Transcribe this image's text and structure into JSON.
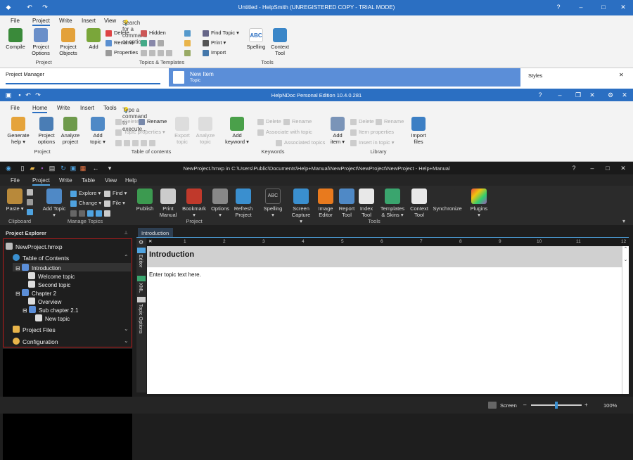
{
  "win1": {
    "title": "Untitled - HelpSmith (UNREGISTERED COPY - TRIAL MODE)",
    "menu": [
      "File",
      "Project",
      "Write",
      "Insert",
      "View"
    ],
    "search_placeholder": "Search for a command or option",
    "ribbon": {
      "compile": "Compile",
      "project_options": "Project Options",
      "project_objects": "Project Objects",
      "add": "Add",
      "delete": "Delete",
      "rename": "Rename",
      "properties": "Properties",
      "hidden": "Hidden",
      "find_topic": "Find Topic",
      "print": "Print",
      "import": "Import",
      "spelling": "Spelling",
      "context_tool": "Context Tool"
    },
    "groups": {
      "project": "Project",
      "topics_templates": "Topics & Templates",
      "tools": "Tools"
    },
    "pane_project_manager": "Project Manager",
    "new_item": "New Item",
    "new_item_sub": "Topic",
    "styles": "Styles"
  },
  "win2": {
    "title": "HelpNDoc Personal Edition 10.4.0.281",
    "menu": [
      "File",
      "Home",
      "Write",
      "Insert",
      "Tools"
    ],
    "search_placeholder": "Type a command to execute...",
    "ribbon": {
      "generate_help": "Generate help",
      "project_options": "Project options",
      "analyze_project": "Analyze project",
      "add_topic": "Add topic",
      "delete": "Delete",
      "rename": "Rename",
      "topic_properties": "Topic properties",
      "export_topic": "Export topic",
      "analyze_topic": "Analyze topic",
      "add_keyword": "Add keyword",
      "kw_delete": "Delete",
      "kw_rename": "Rename",
      "associate_with_topic": "Associate with topic",
      "associated_topics": "Associated topics",
      "add_item": "Add item",
      "lib_delete": "Delete",
      "lib_rename": "Rename",
      "item_properties": "Item properties",
      "insert_in_topic": "Insert in topic",
      "import_files": "Import files"
    },
    "groups": {
      "project": "Project",
      "table_of_contents": "Table of contents",
      "keywords": "Keywords",
      "library": "Library"
    }
  },
  "win3": {
    "title": "NewProject.hmxp in C:\\Users\\Public\\Documents\\Help+Manual\\NewProject\\NewProject\\NewProject - Help+Manual",
    "menu": [
      "File",
      "Project",
      "Write",
      "Table",
      "View",
      "Help"
    ],
    "ribbon": {
      "paste": "Paste",
      "add_topic": "Add Topic",
      "explore": "Explore",
      "change": "Change",
      "find": "Find",
      "file": "File",
      "publish": "Publish",
      "print_manual": "Print Manual",
      "bookmark": "Bookmark",
      "options": "Options",
      "refresh_project": "Refresh Project",
      "spelling": "Spelling",
      "screen_capture": "Screen Capture",
      "image_editor": "Image Editor",
      "report_tool": "Report Tool",
      "index_tool": "Index Tool",
      "templates_skins": "Templates & Skins",
      "context_tool": "Context Tool",
      "synchronize": "Synchronize",
      "plugins": "Plugins"
    },
    "groups": {
      "clipboard": "Clipboard",
      "manage_topics": "Manage Topics",
      "project": "Project",
      "tools": "Tools"
    },
    "explorer_title": "Project Explorer",
    "tree": {
      "root": "NewProject.hmxp",
      "toc": "Table of Contents",
      "introduction": "Introduction",
      "welcome": "Welcome topic",
      "second": "Second topic",
      "chapter2": "Chapter 2",
      "overview": "Overview",
      "sub21": "Sub chapter 2.1",
      "new_topic": "New topic",
      "project_files": "Project Files",
      "configuration": "Configuration"
    },
    "tab": "Introduction",
    "side_tabs": [
      "Editor",
      "XML",
      "Topic Options"
    ],
    "ruler": [
      "1",
      "2",
      "3",
      "4",
      "5",
      "6",
      "7",
      "8",
      "9",
      "10",
      "11",
      "12"
    ],
    "editor_heading": "Introduction",
    "editor_body": "Enter topic text here.",
    "status": {
      "view": "Screen",
      "zoom": "100%"
    }
  }
}
